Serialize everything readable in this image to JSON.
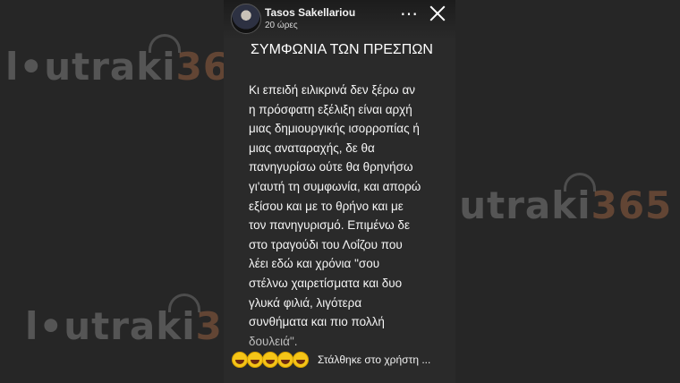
{
  "watermark": {
    "brand": "l•utraki",
    "number": "365"
  },
  "story": {
    "author": "Tasos Sakellariou",
    "time": "20 ώρες",
    "heading": "ΣΥΜΦΩΝΙΑ ΤΩΝ ΠΡΕΣΠΩΝ",
    "lines": [
      "Κι επειδή ειλικρινά δεν ξέρω αν",
      "η πρόσφατη εξέλιξη είναι αρχή",
      "μιας δημιουργικής ισορροπίας ή",
      "μιας αναταραχής, δε θα",
      "πανηγυρίσω ούτε θα θρηνήσω",
      "γι'αυτή τη συμφωνία, και απορώ",
      "εξίσου και με το θρήνο και με",
      "τον πανηγυρισμό. Επιμένω δε",
      "στο τραγούδι του Λοΐζου που",
      "λέει εδώ και χρόνια \"σου",
      "στέλνω χαιρετίσματα και δυο",
      "γλυκά φιλιά, λιγότερα",
      "συνθήματα και πιο πολλή",
      "δουλειά\"."
    ],
    "more_icon": "⋯",
    "sent_to": "Στάλθηκε στο χρήστη ...",
    "reactions": [
      "laughing-emoji",
      "laughing-emoji",
      "laughing-emoji",
      "laughing-emoji",
      "laughing-emoji"
    ]
  },
  "colors": {
    "background": "#262626",
    "story_bg": "#2a2a2a",
    "text": "#f5f5f5",
    "emoji": "#f5c518"
  }
}
